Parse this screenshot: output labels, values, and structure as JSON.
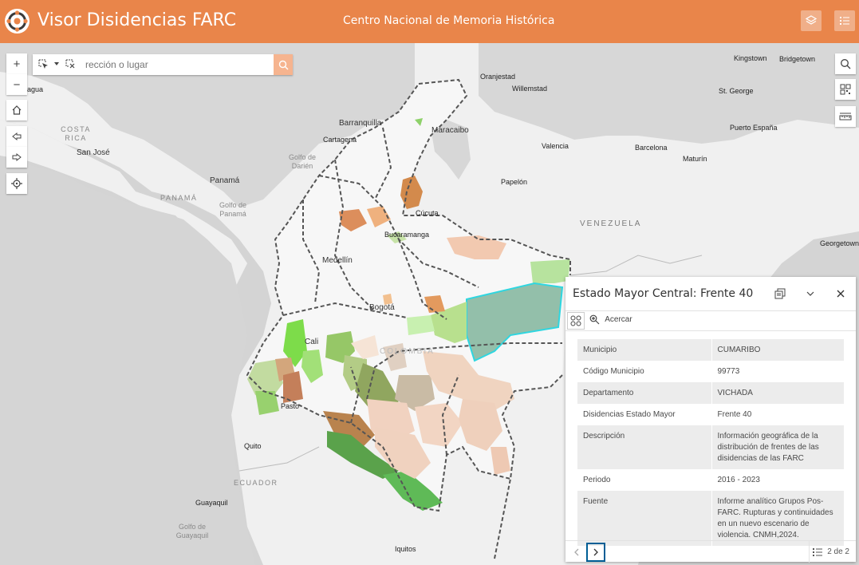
{
  "header": {
    "app_title": "Visor Disidencias FARC",
    "subtitle": "Centro Nacional de Memoria Histórica",
    "colors": {
      "header_bg": "#e9854a",
      "accent_light": "#f6b48f",
      "selected_outline": "#2fd6e0"
    },
    "buttons": [
      "layers-icon",
      "legend-list-icon"
    ]
  },
  "search": {
    "value": "",
    "placeholder": "rección o lugar",
    "icon": "search-icon"
  },
  "map_tools": {
    "zoom_in": "+",
    "zoom_out": "−",
    "left_icons": [
      "zoom-in-icon",
      "zoom-out-icon",
      "home-icon",
      "back-arrow-icon",
      "forward-arrow-icon",
      "locate-icon"
    ],
    "right_icons": [
      "search-icon",
      "qr-code-icon",
      "measure-icon"
    ]
  },
  "map_labels": {
    "cities": [
      "Kingstown",
      "Bridgetown",
      "Oranjestad",
      "Willemstad",
      "St. George",
      "Barranquilla",
      "Maracaibo",
      "Cartagena",
      "Valencia",
      "Barcelona",
      "Maturín",
      "Puerto España",
      "San José",
      "Panamá",
      "Papelón",
      "Cúcuta",
      "Bucaramanga",
      "Georgetown",
      "Medellín",
      "Bogotá",
      "Cali",
      "Pasto",
      "Quito",
      "Guayaquil",
      "Iquitos",
      "nagua"
    ],
    "regions": [
      "COSTA RICA",
      "PANAMÁ",
      "VENEZUELA",
      "COLOMBIA",
      "ECUADOR"
    ],
    "water": [
      "Golfo de Darién",
      "Golfo de Panamá",
      "Golfo de Guayaquil"
    ]
  },
  "popup": {
    "title": "Estado Mayor Central: Frente 40",
    "zoom_label": "Acercar",
    "icons": [
      "dock-icon",
      "collapse-icon",
      "close-icon",
      "select-features-icon",
      "zoom-to-icon"
    ],
    "rows": [
      {
        "key": "Municipio",
        "value": "CUMARIBO"
      },
      {
        "key": "Código Municipio",
        "value": "99773"
      },
      {
        "key": "Departamento",
        "value": "VICHADA"
      },
      {
        "key": "Disidencias Estado Mayor",
        "value": "Frente 40"
      },
      {
        "key": "Descripción",
        "value": "Información geográfica de la distribución de frentes de las disidencias de las FARC"
      },
      {
        "key": "Periodo",
        "value": "2016 - 2023"
      },
      {
        "key": "Fuente",
        "value": "Informe analítico Grupos Pos-FARC. Rupturas y continuidades en un nuevo escenario de violencia. CNMH,2024."
      }
    ],
    "pager": "2 de 2"
  }
}
